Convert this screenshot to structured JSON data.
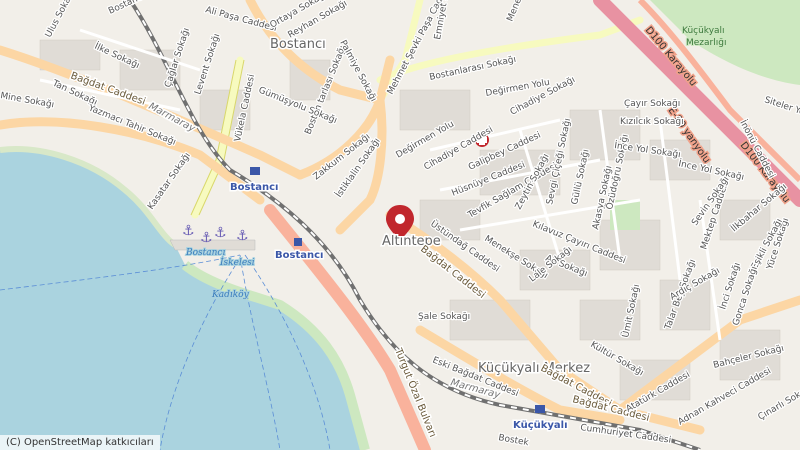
{
  "colors": {
    "sea": "#aad3df",
    "land": "#f2efe9",
    "block": "#e0dcd6",
    "park": "#cde8c0",
    "motorway": "#e892a2",
    "trunk": "#f9b29c",
    "primary": "#fcd6a4",
    "secondary": "#f7fabf",
    "rail": "#707070",
    "marker": "#c1272d"
  },
  "places": {
    "bostanci": "Bostancı",
    "altintepe": "Altıntepe",
    "kucukyali_merkez": "Küçükyalı Merkez"
  },
  "stations": {
    "bostanci_main": "Bostancı",
    "bostanci_marmaray": "Bostancı",
    "kucukyali": "Küçükyalı"
  },
  "ferry": {
    "name": "Bostancı",
    "sub": "İskelesi",
    "route": "Kadıköy"
  },
  "railway": {
    "marmaray_1": "Marmaray",
    "marmaray_2": "Marmaray"
  },
  "cemetery": {
    "line1": "Küçükyalı",
    "line2": "Mezarlığı"
  },
  "highways": {
    "d100_a": "D100 Karayolu",
    "d100_b": "D100 Karayolu",
    "e80": "E-80 yanyolu"
  },
  "streets": {
    "bagdat_1": "Bağdat Caddesi",
    "bagdat_2": "Bağdat Caddesi",
    "bagdat_3": "Bağdat Caddesi",
    "bagdat_4": "Bağdat Caddesi",
    "eski_bagdat": "Eski Bağdat Caddesi",
    "turgut_ozal": "Turgut Özal Bulvarı",
    "ataturk": "Atatürk Caddesi",
    "kasatar": "Kasatar Sokağı",
    "vukela": "Vükela Caddesi",
    "mehmet_sevki": "Mehmet Şevki Paşa Caddesi",
    "bostanarasi": "Bostanlarası Sokağı",
    "degirmen_1": "Değirmen Yolu",
    "degirmen_2": "Değirmen Yolu",
    "cihadiye_1": "Cihadiye Caddesi",
    "cihadiye_2": "Cihadiye Sokağı",
    "galipbey": "Galipbey Caddesi",
    "husnuye": "Hüsnüye Caddesi",
    "tevfik": "Tevfik Sağlam Caddesi",
    "ustundag": "Üstündağ Caddesi",
    "menekse": "Menekşe Sokağı",
    "kilavuz": "Kılavuz Çayırı Caddesi",
    "ak": "Ak Sokağı",
    "lale": "Lale Sokağı",
    "zeytin": "Zeytin Sokağı",
    "sevgi": "Sevgi Çiçeği Sokağı",
    "gullu": "Güllü Sokağı",
    "akasya": "Akasya Sokağı",
    "ozudogru": "Özüdoğru Sokağı",
    "cayir": "Çayır Sokağı",
    "kizilcik": "Kızılcık Sokağı",
    "ince_1": "İnce Yol Sokağı",
    "ince_2": "İnce Yol Sokağı",
    "mektep": "Mektep Caddesi",
    "sevin": "Sevin Sokağı",
    "ilkbahar": "İlkbahar Sokağı",
    "yuce": "Yüce Sokağı",
    "inonu": "İnönü Caddesi",
    "siteler": "Siteler Yolu",
    "esikli": "Eşikli Sokağı",
    "inci": "İnci Sokağı",
    "gonca": "Gonca Sokağı",
    "umit": "Ümit Sokağı",
    "talar_bey": "Talar Bey Sokağı",
    "ardic": "Ardıç Sokağı",
    "kultur": "Kültür Sokağı",
    "bahceler": "Bahçeler Sokağı",
    "adnan": "Adnan Kahveci Caddesi",
    "cinarli": "Çınarlı Sokağı",
    "cumhuriyet": "Cumhuriyet Caddesi",
    "sale": "Şale Sokağı",
    "zakkum": "Zakkum Sokağı",
    "istiklalin": "İstiklalin Sokağı",
    "bostan_tarlasi": "Bostan tarlası Sokağı",
    "gumusyolu": "Gümüşyolu Sokağı",
    "levent": "Levent Sokağı",
    "caglar": "Çağlar Sokağı",
    "ilke": "İlke Sokağı",
    "mine": "Mine Sokağı",
    "tan": "Tan Sokağı",
    "yazmaci": "Yazmacı Tahir Sokağı",
    "ulus": "Ulus Sokağı",
    "ali_pasa": "Ali Paşa Caddesi",
    "ortaya": "Ortaya Sokağı",
    "reyhan": "Reyhan Sokağı",
    "palmiye": "Palmiye Sokağı",
    "emniyet": "Emniyet Sokağı",
    "menekse_top": "Menekşe Sokağı",
    "bostanci_kanal": "Bostancı Kanal",
    "bostek": "Bostek"
  },
  "attribution": "(C) OpenStreetMap katkıcıları"
}
